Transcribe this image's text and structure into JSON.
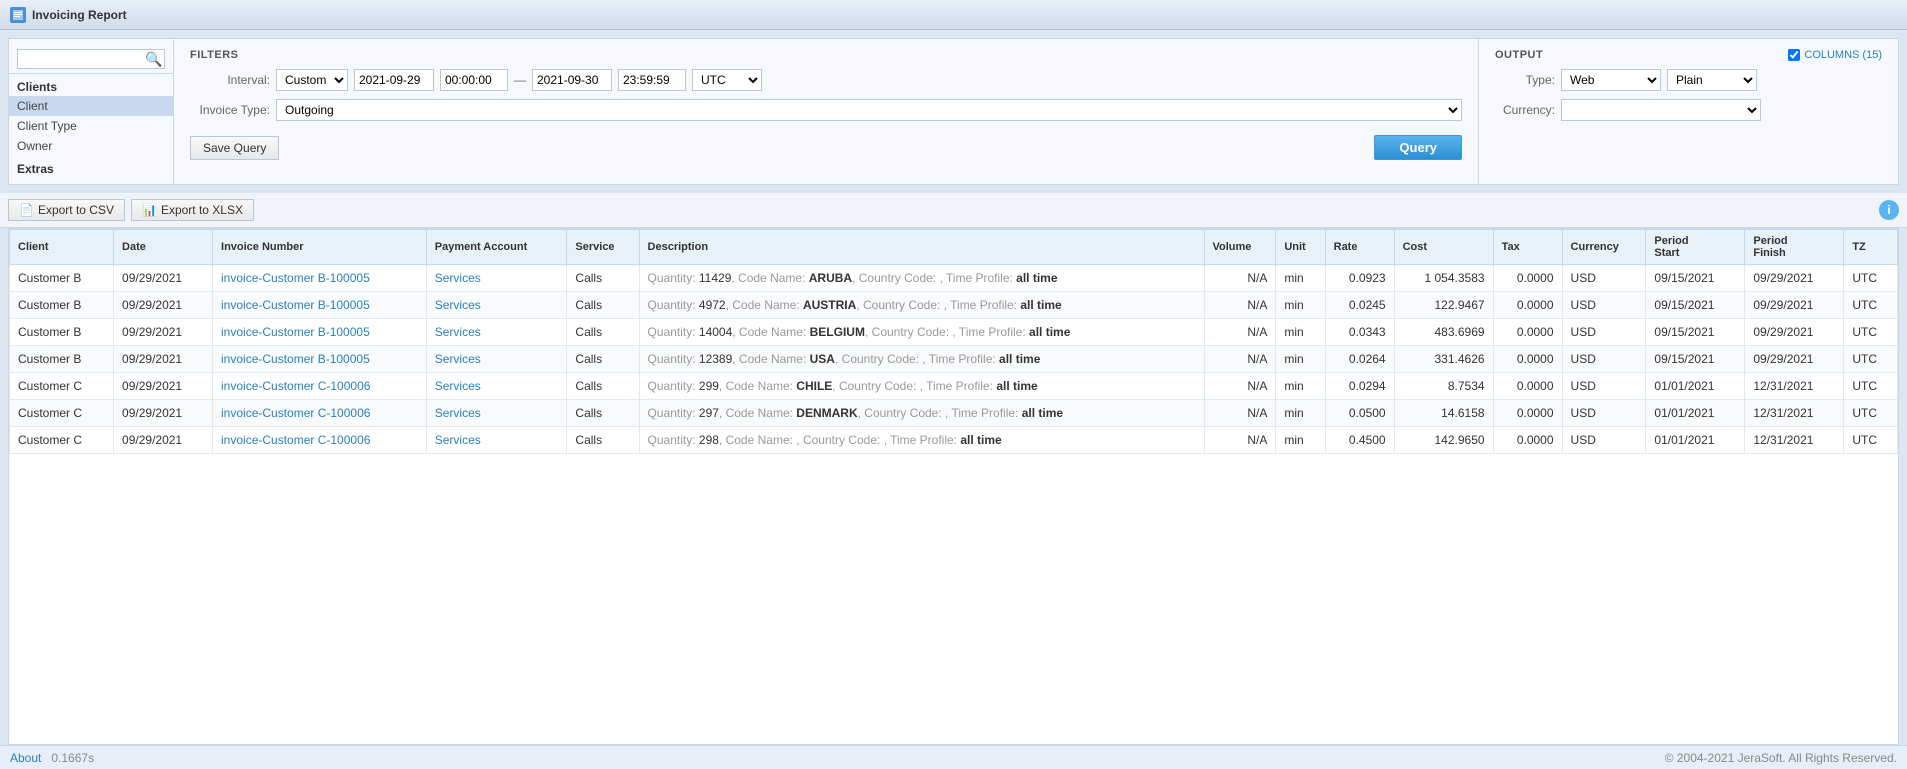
{
  "titleBar": {
    "icon": "report-icon",
    "title": "Invoicing Report"
  },
  "sidebar": {
    "searchPlaceholder": "",
    "groups": [
      {
        "label": "Clients",
        "items": [
          "Client",
          "Client Type",
          "Owner"
        ]
      },
      {
        "label": "Extras",
        "items": []
      }
    ],
    "selectedItem": "Client"
  },
  "filters": {
    "sectionTitle": "FILTERS",
    "intervalLabel": "Interval:",
    "intervalValue": "Custom",
    "dateFrom": "2021-09-29",
    "timeFrom": "00:00:00",
    "dateTo": "2021-09-30",
    "timeTo": "23:59:59",
    "timezone": "UTC",
    "invoiceTypeLabel": "Invoice Type:",
    "invoiceTypeValue": "Outgoing",
    "saveQueryLabel": "Save Query",
    "queryLabel": "Query"
  },
  "output": {
    "sectionTitle": "OUTPUT",
    "columnsLabel": "COLUMNS (15)",
    "typeLabel": "Type:",
    "typeValue": "Web",
    "typePlain": "Plain",
    "currencyLabel": "Currency:",
    "currencyValue": ""
  },
  "toolbar": {
    "exportCsvLabel": "Export to CSV",
    "exportXlsxLabel": "Export to XLSX",
    "infoIcon": "i"
  },
  "table": {
    "columns": [
      "Client",
      "Date",
      "Invoice Number",
      "Payment Account",
      "Service",
      "Description",
      "Volume",
      "Unit",
      "Rate",
      "Cost",
      "Tax",
      "Currency",
      "Period Start",
      "Period Finish",
      "TZ"
    ],
    "rows": [
      {
        "client": "Customer B",
        "date": "09/29/2021",
        "invoiceNumber": "invoice-Customer B-100005",
        "paymentAccount": "Services",
        "service": "Calls",
        "description": "Quantity: 11429, Code Name: ARUBA, Country Code: , Time Profile: all time",
        "descriptionParts": [
          {
            "text": "Quantity: ",
            "style": "gray"
          },
          {
            "text": "11429",
            "style": "normal"
          },
          {
            "text": ", Code Name: ",
            "style": "gray"
          },
          {
            "text": "ARUBA",
            "style": "bold"
          },
          {
            "text": ", Country Code: , Time Profile: ",
            "style": "gray"
          },
          {
            "text": "all time",
            "style": "bold"
          }
        ],
        "volume": "N/A",
        "unit": "min",
        "rate": "0.0923",
        "cost": "1 054.3583",
        "tax": "0.0000",
        "currency": "USD",
        "periodStart": "09/15/2021",
        "periodFinish": "09/29/2021",
        "tz": "UTC"
      },
      {
        "client": "Customer B",
        "date": "09/29/2021",
        "invoiceNumber": "invoice-Customer B-100005",
        "paymentAccount": "Services",
        "service": "Calls",
        "description": "Quantity: 4972, Code Name: AUSTRIA, Country Code: , Time Profile: all time",
        "descriptionParts": [
          {
            "text": "Quantity: ",
            "style": "gray"
          },
          {
            "text": "4972",
            "style": "normal"
          },
          {
            "text": ", Code Name: ",
            "style": "gray"
          },
          {
            "text": "AUSTRIA",
            "style": "bold"
          },
          {
            "text": ", Country Code: , Time Profile: ",
            "style": "gray"
          },
          {
            "text": "all time",
            "style": "bold"
          }
        ],
        "volume": "N/A",
        "unit": "min",
        "rate": "0.0245",
        "cost": "122.9467",
        "tax": "0.0000",
        "currency": "USD",
        "periodStart": "09/15/2021",
        "periodFinish": "09/29/2021",
        "tz": "UTC"
      },
      {
        "client": "Customer B",
        "date": "09/29/2021",
        "invoiceNumber": "invoice-Customer B-100005",
        "paymentAccount": "Services",
        "service": "Calls",
        "description": "Quantity: 14004, Code Name: BELGIUM, Country Code: , Time Profile: all time",
        "descriptionParts": [
          {
            "text": "Quantity: ",
            "style": "gray"
          },
          {
            "text": "14004",
            "style": "normal"
          },
          {
            "text": ", Code Name: ",
            "style": "gray"
          },
          {
            "text": "BELGIUM",
            "style": "bold"
          },
          {
            "text": ", Country Code: , Time Profile: ",
            "style": "gray"
          },
          {
            "text": "all time",
            "style": "bold"
          }
        ],
        "volume": "N/A",
        "unit": "min",
        "rate": "0.0343",
        "cost": "483.6969",
        "tax": "0.0000",
        "currency": "USD",
        "periodStart": "09/15/2021",
        "periodFinish": "09/29/2021",
        "tz": "UTC"
      },
      {
        "client": "Customer B",
        "date": "09/29/2021",
        "invoiceNumber": "invoice-Customer B-100005",
        "paymentAccount": "Services",
        "service": "Calls",
        "description": "Quantity: 12389, Code Name: USA, Country Code: , Time Profile: all time",
        "descriptionParts": [
          {
            "text": "Quantity: ",
            "style": "gray"
          },
          {
            "text": "12389",
            "style": "normal"
          },
          {
            "text": ", Code Name: ",
            "style": "gray"
          },
          {
            "text": "USA",
            "style": "bold"
          },
          {
            "text": ", Country Code: , Time Profile: ",
            "style": "gray"
          },
          {
            "text": "all time",
            "style": "bold"
          }
        ],
        "volume": "N/A",
        "unit": "min",
        "rate": "0.0264",
        "cost": "331.4626",
        "tax": "0.0000",
        "currency": "USD",
        "periodStart": "09/15/2021",
        "periodFinish": "09/29/2021",
        "tz": "UTC"
      },
      {
        "client": "Customer C",
        "date": "09/29/2021",
        "invoiceNumber": "invoice-Customer C-100006",
        "paymentAccount": "Services",
        "service": "Calls",
        "description": "Quantity: 299, Code Name: CHILE, Country Code: , Time Profile: all time",
        "descriptionParts": [
          {
            "text": "Quantity: ",
            "style": "gray"
          },
          {
            "text": "299",
            "style": "normal"
          },
          {
            "text": ", Code Name: ",
            "style": "gray"
          },
          {
            "text": "CHILE",
            "style": "bold"
          },
          {
            "text": ", Country Code: , Time Profile: ",
            "style": "gray"
          },
          {
            "text": "all time",
            "style": "bold"
          }
        ],
        "volume": "N/A",
        "unit": "min",
        "rate": "0.0294",
        "cost": "8.7534",
        "tax": "0.0000",
        "currency": "USD",
        "periodStart": "01/01/2021",
        "periodFinish": "12/31/2021",
        "tz": "UTC"
      },
      {
        "client": "Customer C",
        "date": "09/29/2021",
        "invoiceNumber": "invoice-Customer C-100006",
        "paymentAccount": "Services",
        "service": "Calls",
        "description": "Quantity: 297, Code Name: DENMARK, Country Code: , Time Profile: all time",
        "descriptionParts": [
          {
            "text": "Quantity: ",
            "style": "gray"
          },
          {
            "text": "297",
            "style": "normal"
          },
          {
            "text": ", Code Name: ",
            "style": "gray"
          },
          {
            "text": "DENMARK",
            "style": "bold"
          },
          {
            "text": ", Country Code: , Time Profile: ",
            "style": "gray"
          },
          {
            "text": "all time",
            "style": "bold"
          }
        ],
        "volume": "N/A",
        "unit": "min",
        "rate": "0.0500",
        "cost": "14.6158",
        "tax": "0.0000",
        "currency": "USD",
        "periodStart": "01/01/2021",
        "periodFinish": "12/31/2021",
        "tz": "UTC"
      },
      {
        "client": "Customer C",
        "date": "09/29/2021",
        "invoiceNumber": "invoice-Customer C-100006",
        "paymentAccount": "Services",
        "service": "Calls",
        "description": "Quantity: 298, Code Name: , Country Code: , Time Profile: all time",
        "descriptionParts": [
          {
            "text": "Quantity: ",
            "style": "gray"
          },
          {
            "text": "298",
            "style": "normal"
          },
          {
            "text": ", Code Name: , Country Code: , Time Profile: ",
            "style": "gray"
          },
          {
            "text": "all time",
            "style": "bold"
          }
        ],
        "volume": "N/A",
        "unit": "min",
        "rate": "0.4500",
        "cost": "142.9650",
        "tax": "0.0000",
        "currency": "USD",
        "periodStart": "01/01/2021",
        "periodFinish": "12/31/2021",
        "tz": "UTC"
      }
    ]
  },
  "footer": {
    "aboutLabel": "About",
    "timeValue": "0.1667s",
    "copyright": "© 2004-2021 JeraSoft. All Rights Reserved."
  }
}
